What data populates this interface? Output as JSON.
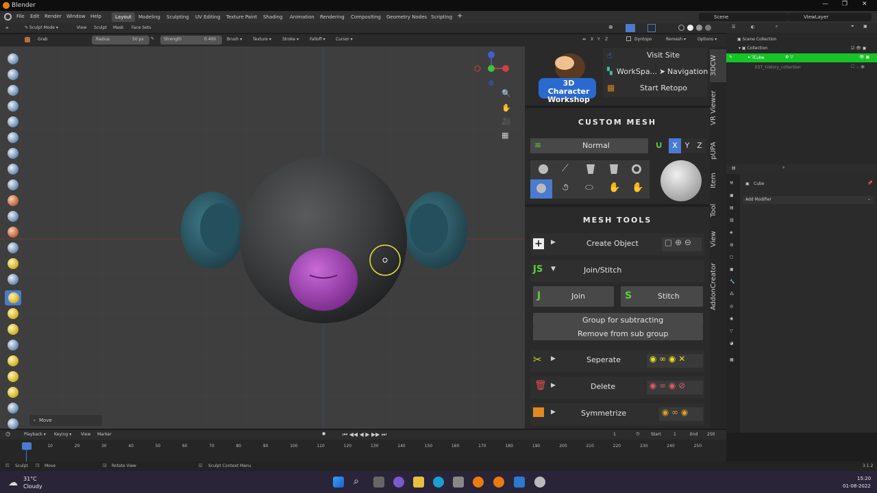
{
  "app": {
    "title": "Blender",
    "version": "3.1.2"
  },
  "menu": [
    "File",
    "Edit",
    "Render",
    "Window",
    "Help"
  ],
  "workspaces": [
    "Layout",
    "Modeling",
    "Sculpting",
    "UV Editing",
    "Texture Paint",
    "Shading",
    "Animation",
    "Rendering",
    "Compositing",
    "Geometry Nodes",
    "Scripting"
  ],
  "active_workspace": "Layout",
  "scene": {
    "name": "Scene",
    "view_layer": "ViewLayer"
  },
  "viewport_header": {
    "mode": "Sculpt Mode",
    "items": [
      "View",
      "Sculpt",
      "Mask",
      "Face Sets"
    ]
  },
  "tool_header": {
    "tool": "Grab",
    "radius_label": "Radius",
    "radius_value": "50 px",
    "strength_label": "Strength",
    "strength_value": "0.400",
    "menus": [
      "Brush",
      "Texture",
      "Stroke",
      "Falloff",
      "Cursor"
    ],
    "right": [
      "Dyntopo",
      "Remesh",
      "Options"
    ],
    "axes": [
      "X",
      "Y",
      "Z"
    ]
  },
  "operator_panel": "Move",
  "npanel": {
    "links": {
      "visit": "Visit Site",
      "workspace": "WorkSpa...",
      "navigation": "Navigation",
      "retopo": "Start Retopo"
    },
    "logo_text": "3D Character Workshop",
    "custom_mesh": {
      "title": "CUSTOM MESH",
      "mode": "Normal",
      "axes": [
        "X",
        "Y",
        "Z"
      ]
    },
    "mesh_tools": {
      "title": "MESH TOOLS",
      "create": "Create Object",
      "join_stitch": "Join/Stitch",
      "join": "Join",
      "stitch": "Stitch",
      "group_sub": "Group for subtracting",
      "remove_sub": "Remove from sub group",
      "seperate": "Seperate",
      "delete": "Delete",
      "symmetrize": "Symmetrize"
    }
  },
  "side_tabs": [
    "3DCW",
    "VR Viewer",
    "pUPA",
    "Item",
    "Tool",
    "View",
    "AddonCreator"
  ],
  "outliner": {
    "root": "Scene Collection",
    "collection": "Collection",
    "cube": "Cube",
    "est": "EST_history_collection"
  },
  "properties": {
    "object": "Cube",
    "add_modifier": "Add Modifier"
  },
  "timeline": {
    "menus": [
      "Playback",
      "Keying",
      "View",
      "Marker"
    ],
    "current_frame": "1",
    "start_label": "Start",
    "start": "1",
    "end_label": "End",
    "end": "250",
    "ticks": [
      "1",
      "10",
      "20",
      "30",
      "40",
      "50",
      "60",
      "70",
      "80",
      "90",
      "100",
      "110",
      "120",
      "130",
      "140",
      "150",
      "160",
      "170",
      "180",
      "190",
      "200",
      "210",
      "220",
      "230",
      "240",
      "250"
    ]
  },
  "status": {
    "sculpt": "Sculpt",
    "move": "Move",
    "rotate": "Rotate View",
    "context": "Sculpt Context Menu"
  },
  "taskbar": {
    "temp": "31°C",
    "weather": "Cloudy",
    "time": "15:20",
    "date": "01-08-2022"
  },
  "colors": {
    "accent_blue": "#4a7bd0",
    "highlight_green": "#17c427",
    "head": "#3a3b3c",
    "ears": "#2f5a66",
    "mouth": "#a24ab8"
  }
}
